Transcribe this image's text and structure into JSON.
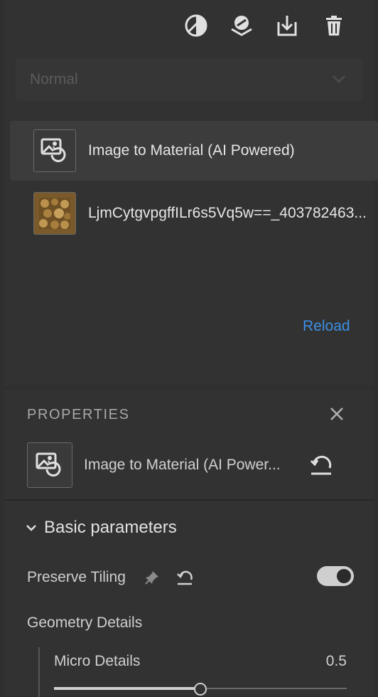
{
  "toolbar": {
    "icons": [
      "contrast-icon",
      "material-sphere-icon",
      "download-icon",
      "trash-icon"
    ]
  },
  "blend": {
    "value": "Normal"
  },
  "layers": [
    {
      "label": "Image to Material (AI Powered)",
      "icon": "image-to-material-icon",
      "selected": true
    },
    {
      "label": "LjmCytgvpgffILr6s5Vq5w==_403782463...",
      "icon": "texture-thumbnail",
      "selected": false
    }
  ],
  "reload_label": "Reload",
  "properties": {
    "header": "PROPERTIES",
    "item_name": "Image to Material (AI Power...",
    "section_title": "Basic parameters",
    "preserve_tiling": {
      "label": "Preserve Tiling",
      "enabled": true
    },
    "geometry_details": {
      "label": "Geometry Details",
      "micro_details": {
        "label": "Micro Details",
        "value": "0.5",
        "fraction": 0.5
      }
    }
  },
  "colors": {
    "accent": "#3d8fe3",
    "panel": "#323232",
    "background": "#2f2f2f"
  }
}
